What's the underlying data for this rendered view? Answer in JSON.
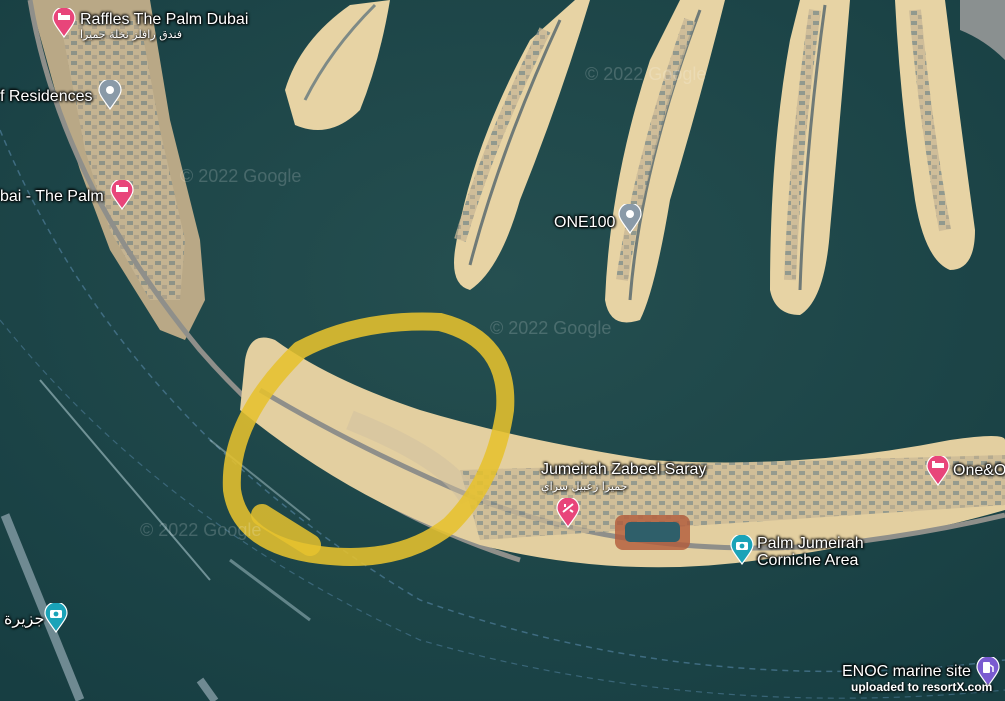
{
  "places": {
    "raffles": {
      "name": "Raffles The Palm Dubai",
      "name_ar": "فندق رافلز نخلة جميرا",
      "icon": "hotel-pin-icon",
      "color": "#e8457a"
    },
    "residences": {
      "name": "f Residences",
      "icon": "place-pin-icon",
      "color": "#8a9aa8"
    },
    "dubai_palm": {
      "name": "bai - The Palm",
      "icon": "hotel-pin-icon",
      "color": "#e8457a"
    },
    "one100": {
      "name": "ONE100",
      "icon": "place-pin-icon",
      "color": "#8a9aa8"
    },
    "zabeel_saray": {
      "name": "Jumeirah Zabeel Saray",
      "name_ar": "جميرا زعبيل سراي",
      "icon": "spa-pin-icon",
      "color": "#e8457a"
    },
    "one_and_only": {
      "name": "One&O",
      "icon": "hotel-pin-icon",
      "color": "#e8457a"
    },
    "corniche": {
      "name": "Palm Jumeirah Corniche Area",
      "line1": "Palm Jumeirah",
      "line2": "Corniche Area",
      "icon": "camera-pin-icon",
      "color": "#1aa3b8"
    },
    "jazeera": {
      "name": "جزيرة",
      "icon": "camera-pin-icon",
      "color": "#1aa3b8"
    },
    "enoc": {
      "name": "ENOC marine site",
      "icon": "fuel-pin-icon",
      "color": "#7a5bd0"
    }
  },
  "watermark": "© 2022 Google",
  "credit": "uploaded to resortX.com",
  "highlight_color": "#e6c22e"
}
